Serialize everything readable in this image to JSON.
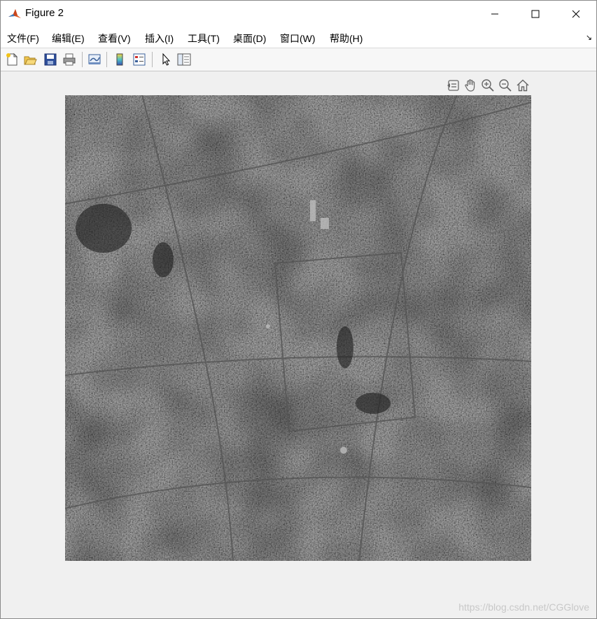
{
  "window": {
    "title": "Figure 2",
    "controls": {
      "minimize": "minimize-icon",
      "maximize": "maximize-icon",
      "close": "close-icon"
    }
  },
  "menubar": {
    "items": [
      {
        "label": "文件(F)"
      },
      {
        "label": "编辑(E)"
      },
      {
        "label": "查看(V)"
      },
      {
        "label": "插入(I)"
      },
      {
        "label": "工具(T)"
      },
      {
        "label": "桌面(D)"
      },
      {
        "label": "窗口(W)"
      },
      {
        "label": "帮助(H)"
      }
    ],
    "dock_arrow": "↘"
  },
  "toolbar": {
    "buttons": [
      "new-figure-icon",
      "open-file-icon",
      "save-icon",
      "print-icon",
      "link-plot-icon",
      "colorbar-icon",
      "legend-icon",
      "select-pointer-icon",
      "property-inspector-icon"
    ]
  },
  "axes_toolbar": {
    "buttons": [
      "export-icon",
      "pan-icon",
      "zoom-in-icon",
      "zoom-out-icon",
      "home-icon"
    ]
  },
  "figure": {
    "content": "grayscale satellite image"
  },
  "watermark": "https://blog.csdn.net/CGGlove",
  "colors": {
    "background": "#f0f0f0",
    "titlebar": "#ffffff"
  }
}
